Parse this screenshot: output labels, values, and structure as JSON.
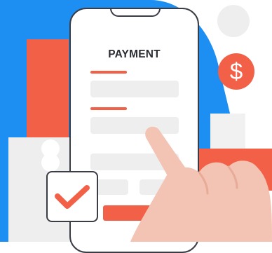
{
  "payment_screen": {
    "title": "PAYMENT"
  },
  "badge": {
    "symbol": "$"
  },
  "colors": {
    "accent_red": "#f26048",
    "blue_blob": "#1e8ff2",
    "outline": "#3a3d46",
    "field_gray": "#eeeeef",
    "skin": "#f3c3b3"
  },
  "icons": [
    "check-icon",
    "dollar-icon",
    "pointing-hand-icon"
  ]
}
